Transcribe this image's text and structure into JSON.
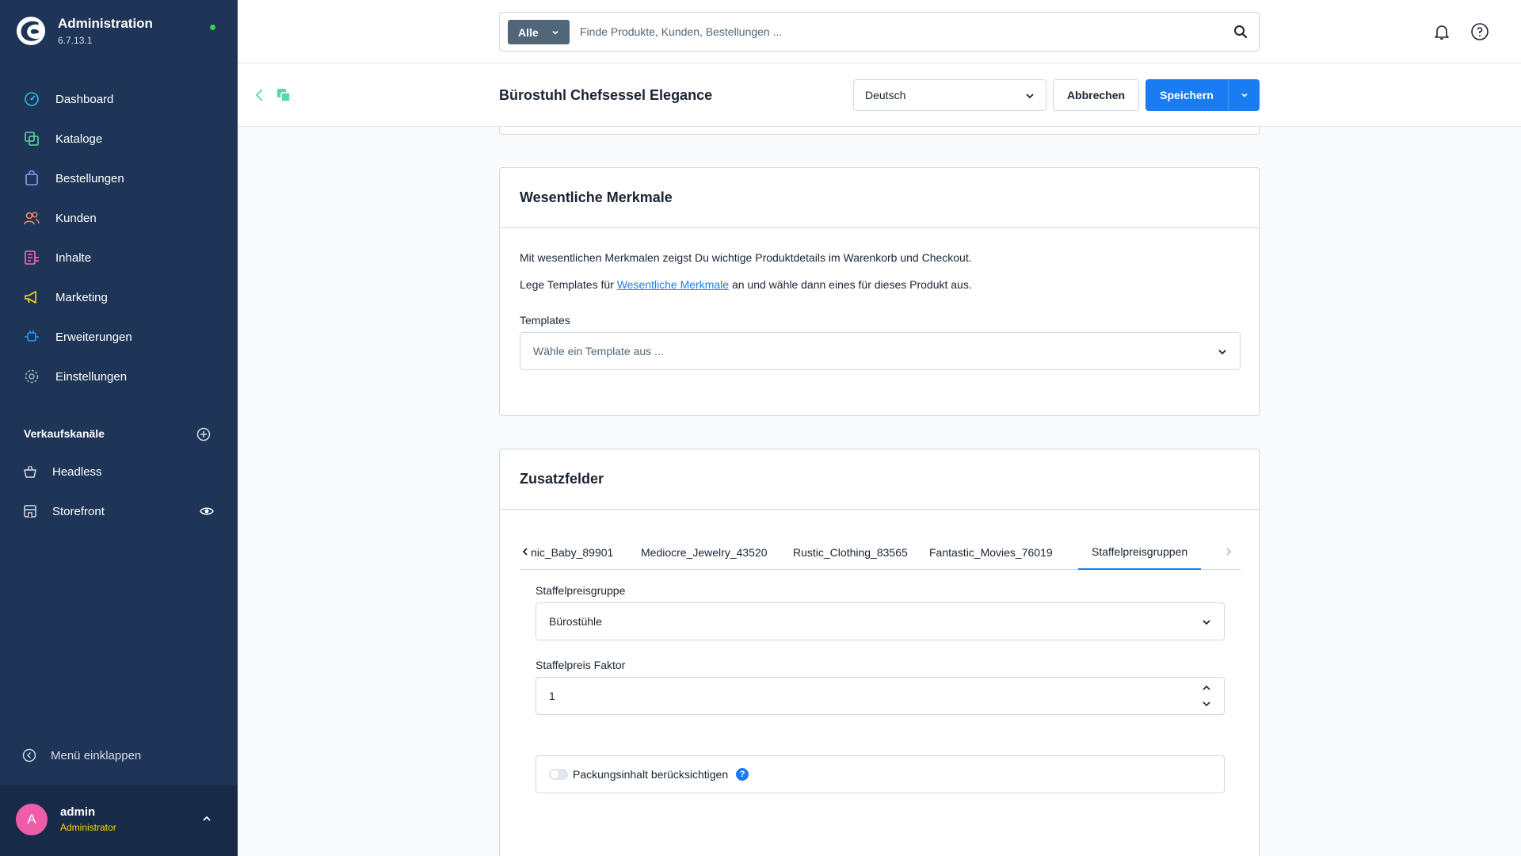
{
  "app": {
    "title": "Administration",
    "version": "6.7.13.1"
  },
  "nav": [
    {
      "label": "Dashboard",
      "icon": "dashboard-icon",
      "color": "#36b8e6"
    },
    {
      "label": "Kataloge",
      "icon": "catalog-icon",
      "color": "#57d9a3"
    },
    {
      "label": "Bestellungen",
      "icon": "shopping-bag-icon",
      "color": "#a092f0"
    },
    {
      "label": "Kunden",
      "icon": "users-icon",
      "color": "#f88962"
    },
    {
      "label": "Inhalte",
      "icon": "content-icon",
      "color": "#ff68b4"
    },
    {
      "label": "Marketing",
      "icon": "megaphone-icon",
      "color": "#ffd700"
    },
    {
      "label": "Erweiterungen",
      "icon": "plug-icon",
      "color": "#189eff"
    },
    {
      "label": "Einstellungen",
      "icon": "gear-icon",
      "color": "#9aa8b5"
    }
  ],
  "sales_channels": {
    "title": "Verkaufskanäle",
    "items": [
      {
        "label": "Headless",
        "icon": "basket-icon"
      },
      {
        "label": "Storefront",
        "icon": "storefront-icon"
      }
    ]
  },
  "collapse_label": "Menü einklappen",
  "user": {
    "initial": "A",
    "name": "admin",
    "role": "Administrator"
  },
  "search": {
    "chip": "Alle",
    "placeholder": "Finde Produkte, Kunden, Bestellungen ..."
  },
  "smartbar": {
    "title": "Bürostuhl Chefsessel Elegance",
    "language": "Deutsch",
    "cancel": "Abbrechen",
    "save": "Speichern"
  },
  "essential": {
    "title": "Wesentliche Merkmale",
    "text1": "Mit wesentlichen Merkmalen zeigst Du wichtige Produktdetails im Warenkorb und Checkout.",
    "text2_prefix": "Lege Templates für",
    "text2_link": "Wesentliche Merkmale",
    "text2_suffix": "an und wähle dann eines für dieses Produkt aus.",
    "templates_label": "Templates",
    "templates_placeholder": "Wähle ein Template aus ..."
  },
  "custom_fields": {
    "title": "Zusatzfelder",
    "tabs": [
      "nic_Baby_89901",
      "Mediocre_Jewelry_43520",
      "Rustic_Clothing_83565",
      "Fantastic_Movies_76019",
      "Staffelpreisgruppen"
    ],
    "active_tab": "Staffelpreisgruppen",
    "group_label": "Staffelpreisgruppe",
    "group_value": "Bürostühle",
    "factor_label": "Staffelpreis Faktor",
    "factor_value": "1",
    "toggle_label": "Packungsinhalt berücksichtigen",
    "toggle_on": false,
    "help": "?"
  },
  "colors": {
    "sidebar": "#1e3557",
    "primary": "#1a7cf2",
    "status": "#37d046",
    "avatar": "#ef5da8"
  }
}
